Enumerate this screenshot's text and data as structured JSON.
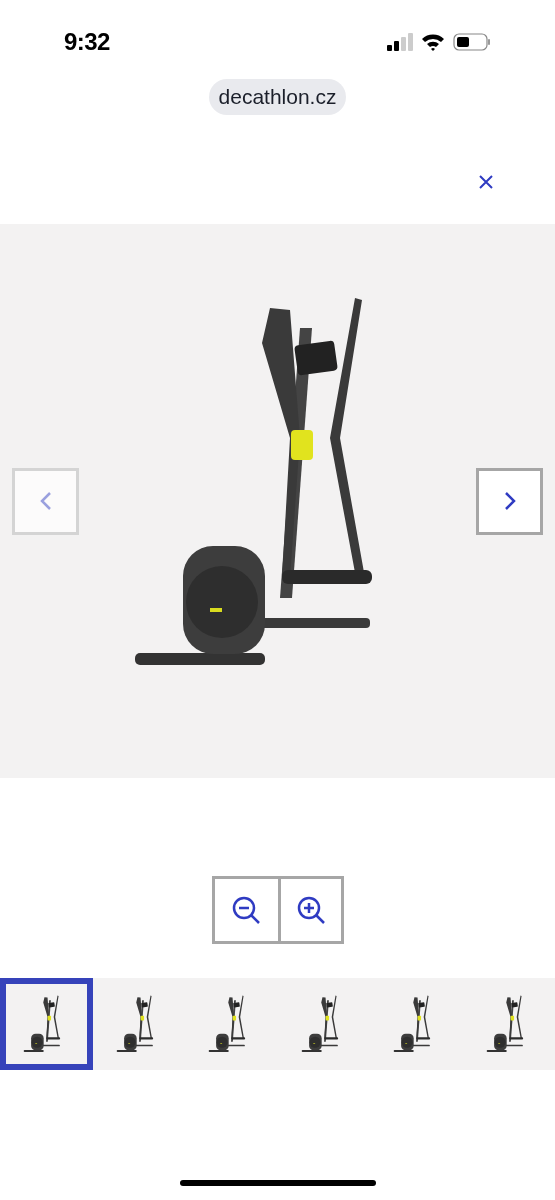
{
  "status_bar": {
    "time": "9:32"
  },
  "address_bar": {
    "url": "decathlon.cz"
  },
  "gallery": {
    "prev_button": {
      "disabled": true
    },
    "next_button": {
      "disabled": false
    }
  },
  "zoom_controls": [
    {
      "kind": "zoom-out"
    },
    {
      "kind": "zoom-in"
    }
  ],
  "thumbnails": [
    {
      "selected": true
    },
    {
      "selected": false
    },
    {
      "selected": false
    },
    {
      "selected": false
    },
    {
      "selected": false
    },
    {
      "selected": false
    }
  ]
}
